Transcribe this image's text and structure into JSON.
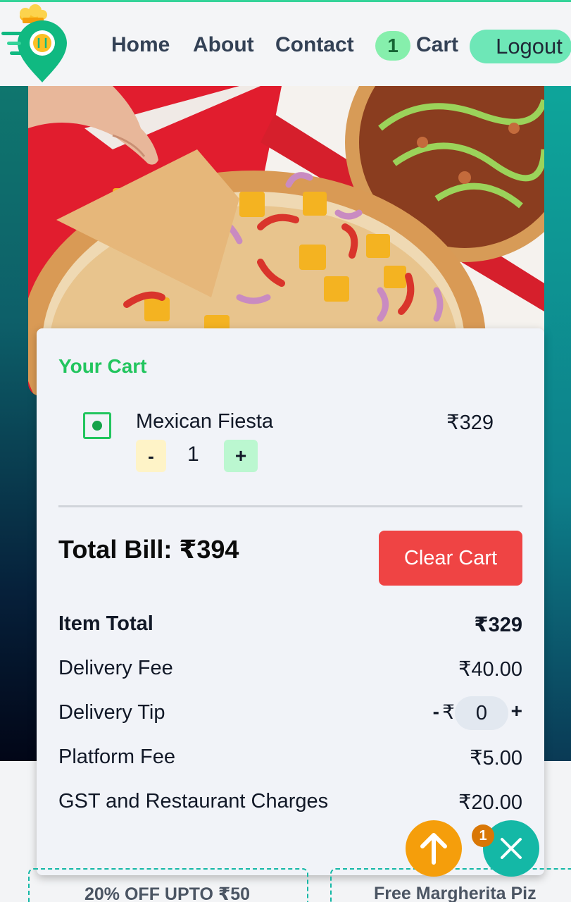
{
  "nav": {
    "links": [
      {
        "label": "Home"
      },
      {
        "label": "About"
      },
      {
        "label": "Contact"
      }
    ],
    "cart_count": "1",
    "cart_label": "Cart",
    "logout_label": "Logout"
  },
  "cart": {
    "heading": "Your Cart",
    "items": [
      {
        "name": "Mexican Fiesta",
        "price": "₹329",
        "qty": "1",
        "minus": "-",
        "plus": "+"
      }
    ],
    "total_bill": "Total Bill: ₹394",
    "clear_label": "Clear Cart",
    "bill": {
      "item_total_label": "Item Total",
      "item_total": "₹329",
      "delivery_fee_label": "Delivery Fee",
      "delivery_fee": "₹40.00",
      "tip_label": "Delivery Tip",
      "tip_minus": "-",
      "tip_currency": "₹",
      "tip_value": "0",
      "tip_plus": "+",
      "platform_fee_label": "Platform Fee",
      "platform_fee": "₹5.00",
      "gst_label": "GST and Restaurant Charges",
      "gst": "₹20.00"
    }
  },
  "fab": {
    "badge": "1",
    "scroll_icon": "arrow-up-icon",
    "close_icon": "close-icon"
  },
  "offers": [
    {
      "text": "20% OFF UPTO ₹50"
    },
    {
      "text": "Free Margherita Piz"
    }
  ],
  "colors": {
    "brand_green": "#22c55e",
    "accent_teal": "#14b8a6",
    "danger": "#ef4444",
    "warning": "#f59e0b"
  }
}
